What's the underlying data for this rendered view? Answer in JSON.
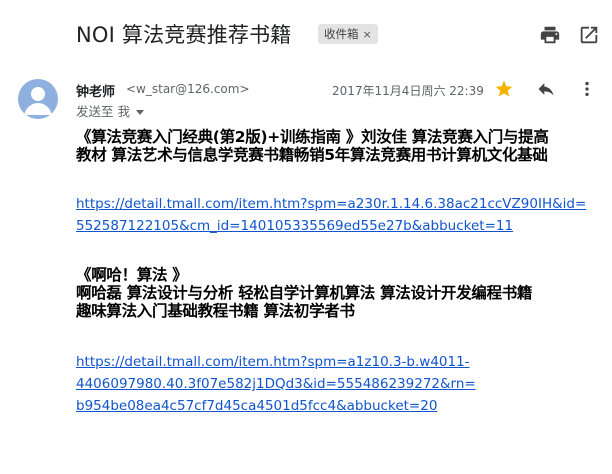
{
  "email": {
    "subject": "NOI 算法竞赛推荐书籍",
    "label": "收件箱",
    "label_remove": "×",
    "sender_name": "钟老师",
    "sender_email": "<w_star@126.com>",
    "sent_to": "发送至 我",
    "date": "2017年11月4日周六 22:39",
    "starred": true
  },
  "icons": {
    "print": "print-icon",
    "open_new_window": "open-in-new-window-icon",
    "star": "star-icon",
    "reply": "reply-icon",
    "more": "more-vert-icon",
    "avatar": "person-icon"
  },
  "colors": {
    "star": "#f4b400",
    "link": "#1155cc",
    "avatar_bg": "#8fb0de",
    "chip_bg": "#e3e3e3"
  },
  "body": {
    "book1": {
      "lines": [
        "《算法竞赛入门经典(第2版)+训练指南 》刘汝佳 算法竞赛入门与提高",
        "教材 算法艺术与信息学竞赛书籍畅销5年算法竞赛用书计算机文化基础"
      ],
      "link_lines": [
        "https://detail.tmall.com/item.htm?spm=a230r.1.14.6.38ac21ccVZ90IH&id=",
        "552587122105&cm_id=140105335569ed55e27b&abbucket=11"
      ]
    },
    "book2": {
      "title": "《啊哈！算法 》",
      "lines": [
        "啊哈磊 算法设计与分析 轻松自学计算机算法 算法设计开发编程书籍",
        "趣味算法入门基础教程书籍 算法初学者书"
      ],
      "link_lines": [
        "https://detail.tmall.com/item.htm?spm=a1z10.3-b.w4011-",
        "4406097980.40.3f07e582j1DQd3&id=555486239272&rn=",
        "b954be08ea4c57cf7d45ca4501d5fcc4&abbucket=20"
      ]
    }
  }
}
